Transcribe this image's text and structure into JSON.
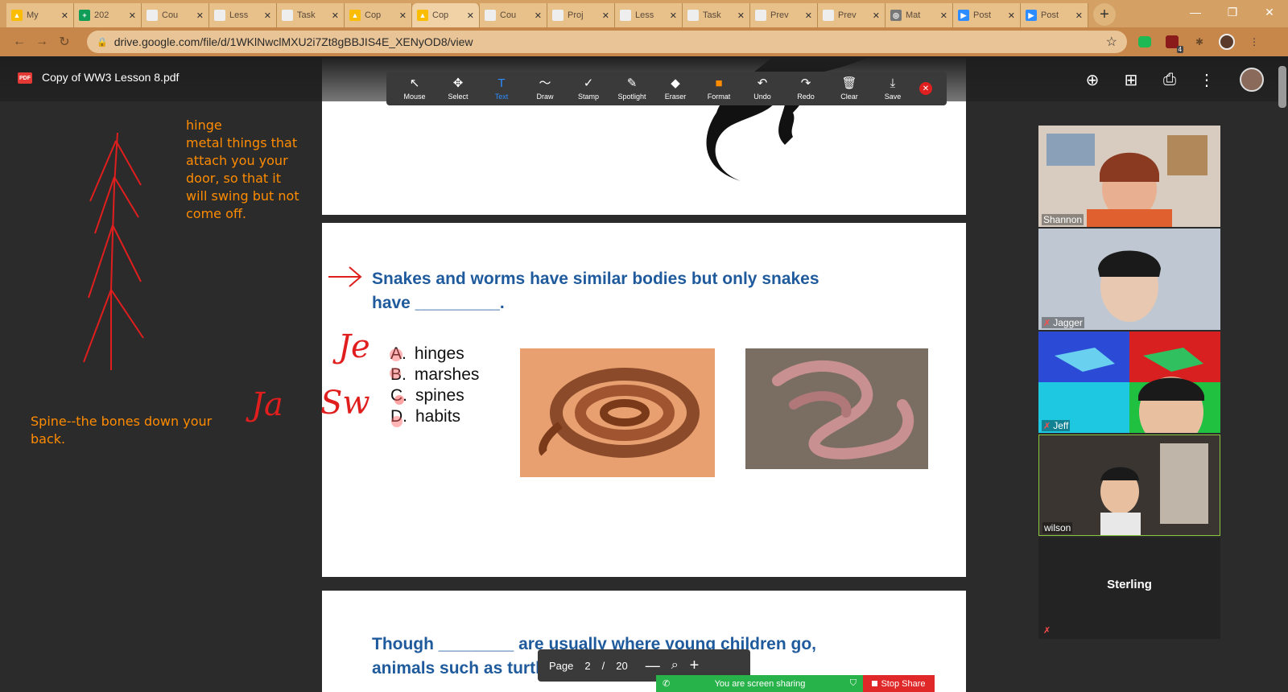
{
  "browser": {
    "tabs": [
      {
        "label": "My",
        "favicon_color": "#fbbc04",
        "favicon_glyph": "▲"
      },
      {
        "label": "202",
        "favicon_color": "#0f9d58",
        "favicon_glyph": "+"
      },
      {
        "label": "Cou",
        "favicon_color": "#eeeeee",
        "favicon_glyph": ""
      },
      {
        "label": "Less",
        "favicon_color": "#eeeeee",
        "favicon_glyph": ""
      },
      {
        "label": "Task",
        "favicon_color": "#eeeeee",
        "favicon_glyph": ""
      },
      {
        "label": "Cop",
        "favicon_color": "#fbbc04",
        "favicon_glyph": "▲"
      },
      {
        "label": "Cop",
        "favicon_color": "#fbbc04",
        "favicon_glyph": "▲"
      },
      {
        "label": "Cou",
        "favicon_color": "#eeeeee",
        "favicon_glyph": ""
      },
      {
        "label": "Proj",
        "favicon_color": "#eeeeee",
        "favicon_glyph": ""
      },
      {
        "label": "Less",
        "favicon_color": "#eeeeee",
        "favicon_glyph": ""
      },
      {
        "label": "Task",
        "favicon_color": "#eeeeee",
        "favicon_glyph": ""
      },
      {
        "label": "Prev",
        "favicon_color": "#eeeeee",
        "favicon_glyph": ""
      },
      {
        "label": "Prev",
        "favicon_color": "#eeeeee",
        "favicon_glyph": ""
      },
      {
        "label": "Mat",
        "favicon_color": "#777777",
        "favicon_glyph": "◎"
      },
      {
        "label": "Post",
        "favicon_color": "#2d8cff",
        "favicon_glyph": "▶"
      },
      {
        "label": "Post",
        "favicon_color": "#2d8cff",
        "favicon_glyph": "▶"
      }
    ],
    "active_tab_index": 6,
    "url": "drive.google.com/file/d/1WKlNwclMXU2i7Zt8gBBJIS4E_XENyOD8/view",
    "ext_badge_count": "4"
  },
  "viewer": {
    "filename": "Copy of WW3 Lesson 8.pdf",
    "pdf_badge": "PDF"
  },
  "annotation_toolbar": {
    "items": [
      {
        "label": "Mouse",
        "icon": "↖"
      },
      {
        "label": "Select",
        "icon": "✥"
      },
      {
        "label": "Text",
        "icon": "T"
      },
      {
        "label": "Draw",
        "icon": "〜"
      },
      {
        "label": "Stamp",
        "icon": "✓"
      },
      {
        "label": "Spotlight",
        "icon": "✎"
      },
      {
        "label": "Eraser",
        "icon": "◆"
      },
      {
        "label": "Format",
        "icon": "■"
      },
      {
        "label": "Undo",
        "icon": "↶"
      },
      {
        "label": "Redo",
        "icon": "↷"
      },
      {
        "label": "Clear",
        "icon": "🗑"
      },
      {
        "label": "Save",
        "icon": "⤓"
      }
    ],
    "format_color": "#ff8c00"
  },
  "notes": {
    "hinge_lines": [
      "hinge",
      "metal things that",
      "attach you your",
      "door, so that it",
      "will swing but not",
      "come off."
    ],
    "spine_lines": [
      "Spine--the bones down your",
      "back."
    ]
  },
  "page2": {
    "question_line1": "Snakes and worms have similar bodies but only snakes",
    "question_line2": "have _________.",
    "answers": [
      {
        "letter": "A.",
        "text": "hinges"
      },
      {
        "letter": "B.",
        "text": "marshes"
      },
      {
        "letter": "C.",
        "text": "spines"
      },
      {
        "letter": "D.",
        "text": "habits"
      }
    ]
  },
  "page3": {
    "line1_start": "Though ________",
    "line1_end": "are usually where young children go,",
    "line2": "animals such as turtles are also r"
  },
  "handwriting": {
    "je": "Je",
    "ja": "Ja",
    "sw": "Sw"
  },
  "participants": [
    {
      "name": "Shannon",
      "muted": false
    },
    {
      "name": "Jagger",
      "muted": true
    },
    {
      "name": "Jeff",
      "muted": true
    },
    {
      "name": "wilson",
      "muted": false
    },
    {
      "name": "Sterling",
      "muted": true
    }
  ],
  "page_nav": {
    "label": "Page",
    "current": "2",
    "separator": "/",
    "total": "20"
  },
  "share_bar": {
    "status": "You are screen sharing",
    "stop_label": "Stop Share"
  }
}
